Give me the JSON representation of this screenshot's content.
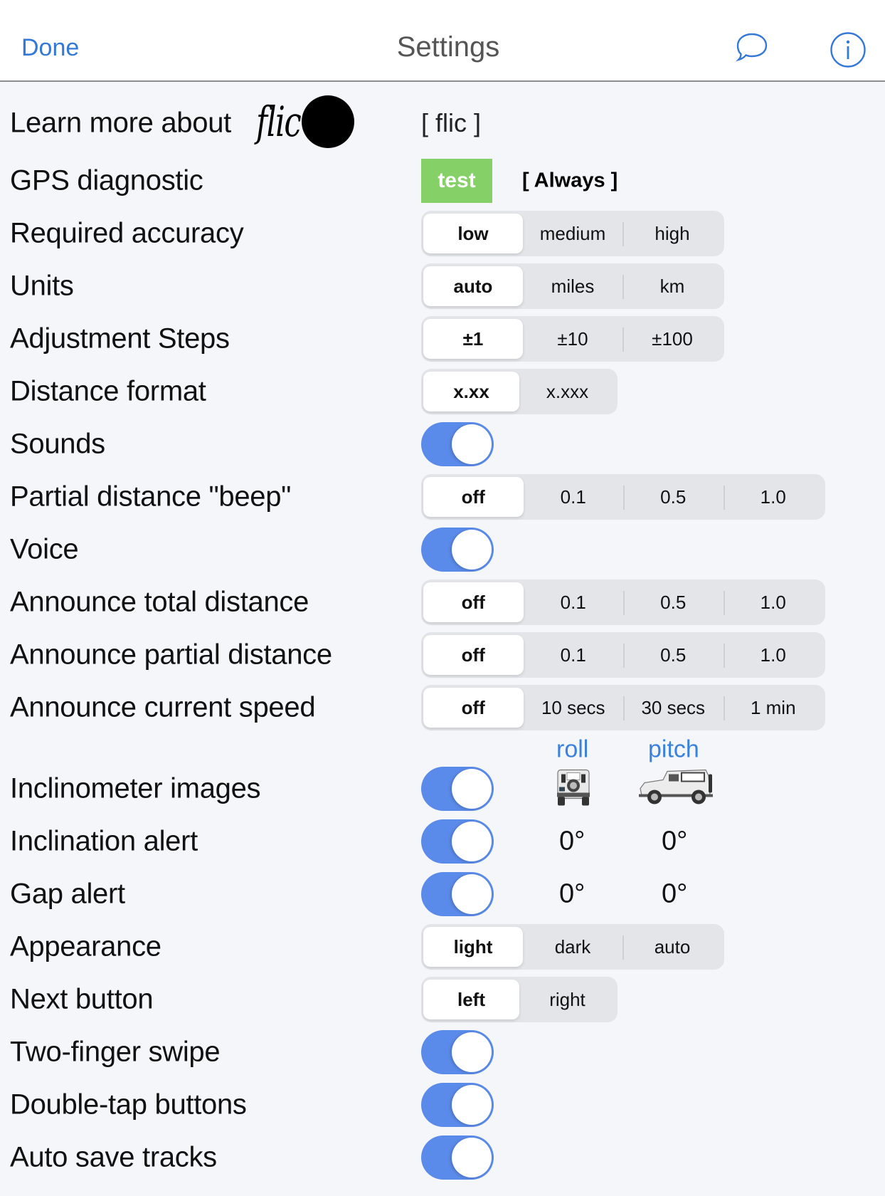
{
  "header": {
    "done_label": "Done",
    "title": "Settings",
    "icons": [
      "chat-bubble-icon",
      "info-icon"
    ]
  },
  "accent_color": "#3478d8",
  "toggle_color": "#5b8bea",
  "rows": {
    "learn_more": {
      "label": "Learn more about",
      "logo_text": "flic",
      "link": "[ flic ]"
    },
    "gps": {
      "label": "GPS diagnostic",
      "test_label": "test",
      "mode": "[ Always ]"
    },
    "accuracy": {
      "label": "Required accuracy",
      "options": [
        "low",
        "medium",
        "high"
      ],
      "selected": "low"
    },
    "units": {
      "label": "Units",
      "options": [
        "auto",
        "miles",
        "km"
      ],
      "selected": "auto"
    },
    "steps": {
      "label": "Adjustment Steps",
      "options": [
        "±1",
        "±10",
        "±100"
      ],
      "selected": "±1"
    },
    "distance_format": {
      "label": "Distance format",
      "options": [
        "x.xx",
        "x.xxx"
      ],
      "selected": "x.xx"
    },
    "sounds": {
      "label": "Sounds",
      "on": true
    },
    "beep": {
      "label": "Partial distance \"beep\"",
      "options": [
        "off",
        "0.1",
        "0.5",
        "1.0"
      ],
      "selected": "off"
    },
    "voice": {
      "label": "Voice",
      "on": true
    },
    "announce_total": {
      "label": "Announce total distance",
      "options": [
        "off",
        "0.1",
        "0.5",
        "1.0"
      ],
      "selected": "off"
    },
    "announce_partial": {
      "label": "Announce partial distance",
      "options": [
        "off",
        "0.1",
        "0.5",
        "1.0"
      ],
      "selected": "off"
    },
    "announce_speed": {
      "label": "Announce current speed",
      "options": [
        "off",
        "10 secs",
        "30 secs",
        "1 min"
      ],
      "selected": "off"
    },
    "incl_headers": {
      "roll": "roll",
      "pitch": "pitch"
    },
    "incl_images": {
      "label": "Inclinometer images",
      "on": true
    },
    "incl_alert": {
      "label": "Inclination alert",
      "on": true,
      "roll": "0°",
      "pitch": "0°"
    },
    "gap_alert": {
      "label": "Gap alert",
      "on": true,
      "roll": "0°",
      "pitch": "0°"
    },
    "appearance": {
      "label": "Appearance",
      "options": [
        "light",
        "dark",
        "auto"
      ],
      "selected": "light"
    },
    "next_button": {
      "label": "Next button",
      "options": [
        "left",
        "right"
      ],
      "selected": "left"
    },
    "two_finger": {
      "label": "Two-finger swipe",
      "on": true
    },
    "double_tap": {
      "label": "Double-tap buttons",
      "on": true
    },
    "auto_save": {
      "label": "Auto save tracks",
      "on": true
    }
  }
}
